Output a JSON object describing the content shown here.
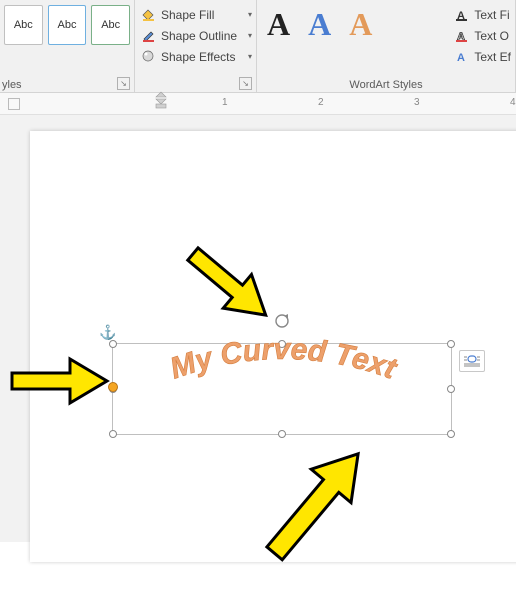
{
  "ribbon": {
    "shapes_group": {
      "abc": "Abc",
      "label": "yles"
    },
    "shape_styles": {
      "fill": "Shape Fill",
      "outline": "Shape Outline",
      "effects": "Shape Effects"
    },
    "wordart": {
      "label": "WordArt Styles",
      "text_fill": "Text Fi",
      "text_outline": "Text O",
      "text_effects": "Text Ef"
    }
  },
  "ruler": {
    "marks": [
      "1",
      "2",
      "3",
      "4"
    ]
  },
  "textbox": {
    "content": "My Curved Text"
  },
  "colors": {
    "accent_orange": "#e39a5a",
    "accent_blue": "#4a7dd1",
    "arrow_fill": "#ffe600"
  }
}
